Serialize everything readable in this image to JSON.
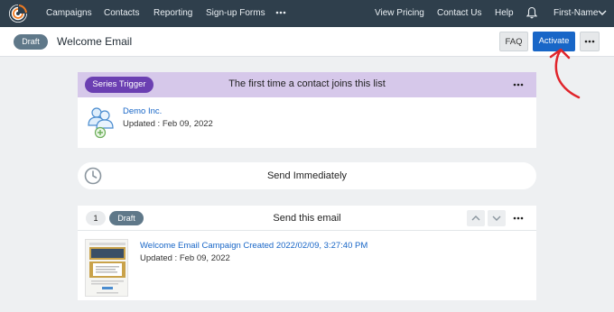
{
  "nav": {
    "items": [
      "Campaigns",
      "Contacts",
      "Reporting",
      "Sign-up Forms"
    ],
    "more_icon": "more-horizontal-icon",
    "right_items": [
      "View Pricing",
      "Contact Us",
      "Help"
    ],
    "bell_icon": "bell-icon",
    "user_label": "First-Name",
    "user_chevron_icon": "chevron-down-icon"
  },
  "header": {
    "status": "Draft",
    "title": "Welcome Email",
    "faq_label": "FAQ",
    "activate_label": "Activate",
    "more_icon": "more-horizontal-icon"
  },
  "trigger": {
    "badge": "Series Trigger",
    "title": "The first time a contact joins this list",
    "list_name": "Demo Inc.",
    "updated": "Updated : Feb 09, 2022"
  },
  "send": {
    "label": "Send Immediately",
    "icon": "clock-icon"
  },
  "email": {
    "step": "1",
    "status": "Draft",
    "title": "Send this email",
    "name": "Welcome Email Campaign Created 2022/02/09, 3:27:40 PM",
    "updated": "Updated : Feb 09, 2022"
  },
  "colors": {
    "nav_bg": "#2f3f4c",
    "brand_orange": "#f07b22",
    "activate_blue": "#1866c7",
    "trigger_bg": "#d6c8ea",
    "trigger_badge": "#6b3fb2",
    "draft_badge": "#5f7889",
    "annotation_red": "#e0242b"
  }
}
